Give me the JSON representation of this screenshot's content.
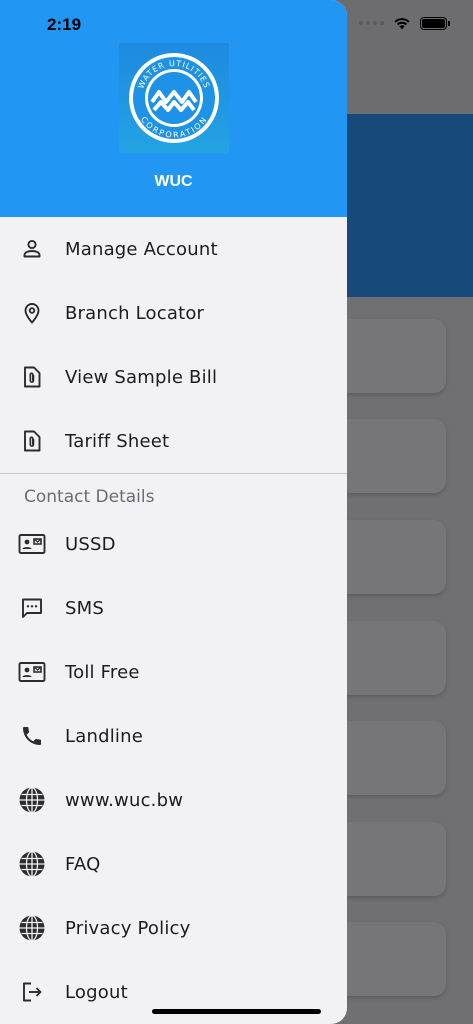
{
  "status_bar": {
    "time": "2:19"
  },
  "header": {
    "app_name": "WUC",
    "logo_text_top": "WATER UTILITIES",
    "logo_text_bottom": "CORPORATION",
    "brand_color": "#2196f3"
  },
  "menu": [
    {
      "label": "Manage Account",
      "icon": "person-icon"
    },
    {
      "label": "Branch Locator",
      "icon": "location-pin-icon"
    },
    {
      "label": "View Sample Bill",
      "icon": "document-attachment-icon"
    },
    {
      "label": "Tariff Sheet",
      "icon": "document-attachment-icon"
    }
  ],
  "contact_section": {
    "title": "Contact Details",
    "items": [
      {
        "label": "USSD",
        "icon": "contact-card-icon"
      },
      {
        "label": "SMS",
        "icon": "message-dots-icon"
      },
      {
        "label": "Toll Free",
        "icon": "contact-card-icon"
      },
      {
        "label": "Landline",
        "icon": "phone-icon"
      },
      {
        "label": "www.wuc.bw",
        "icon": "globe-icon"
      },
      {
        "label": "FAQ",
        "icon": "globe-icon"
      },
      {
        "label": "Privacy Policy",
        "icon": "globe-icon"
      },
      {
        "label": "Logout",
        "icon": "logout-icon"
      }
    ]
  }
}
